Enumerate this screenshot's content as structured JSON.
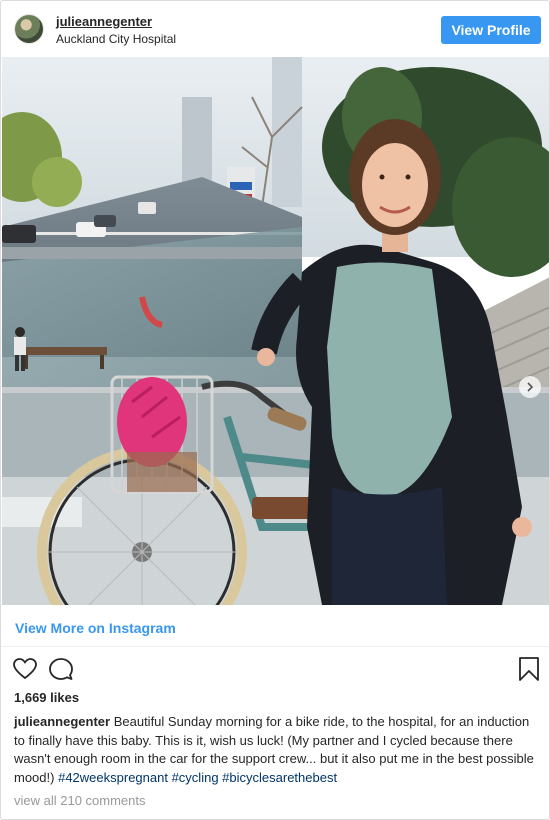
{
  "header": {
    "username": "julieannegenter",
    "location": "Auckland City Hospital",
    "view_profile_label": "View Profile"
  },
  "post": {
    "view_more_label": "View More on Instagram",
    "likes": "1,669 likes",
    "caption_user": "julieannegenter",
    "caption_text": "Beautiful Sunday morning for a bike ride, to the hospital, for an induction to finally have this baby. This is it, wish us luck! (My partner and I cycled because there wasn't enough room in the car for the support crew... but it also put me in the best possible mood!)",
    "hashtags": [
      "#42weekspregnant",
      "#cycling",
      "#bicyclesarethebest"
    ],
    "comments_link": "view all 210 comments"
  },
  "icons": {
    "like": "heart-icon",
    "comment": "comment-icon",
    "save": "bookmark-icon",
    "carousel_next": "chevron-right-icon"
  },
  "colors": {
    "accent": "#3897f0",
    "hashtag": "#003569",
    "muted": "#999999",
    "text": "#262626"
  }
}
